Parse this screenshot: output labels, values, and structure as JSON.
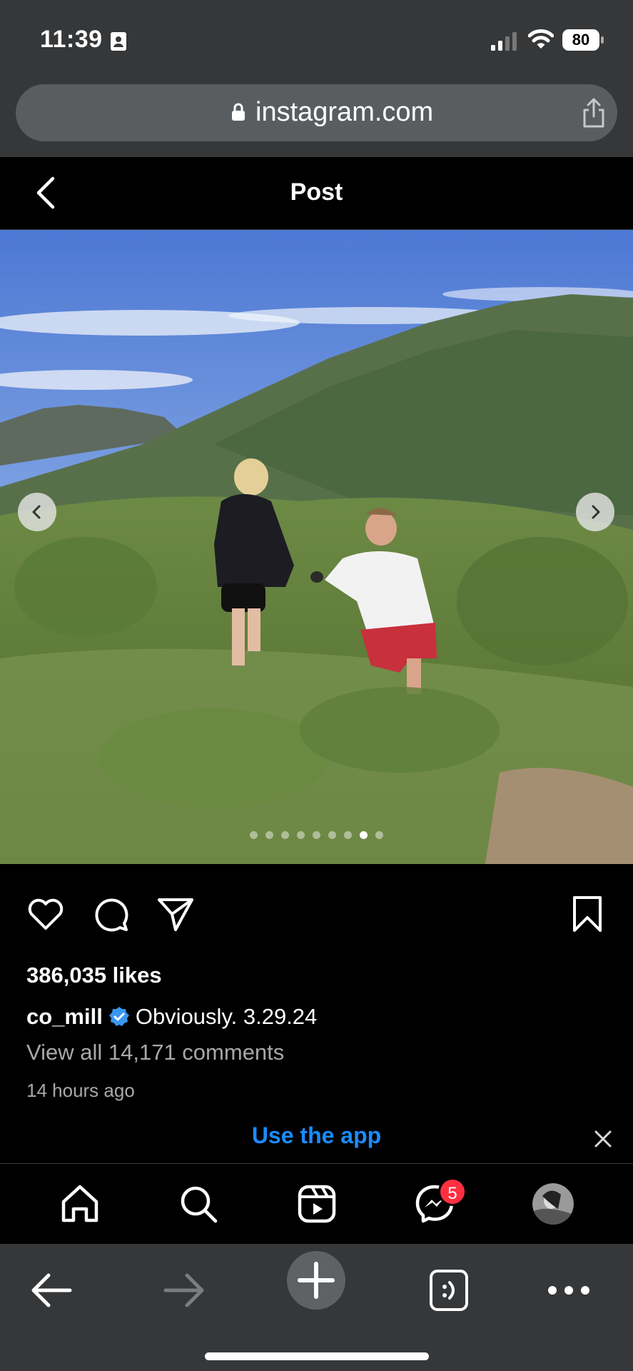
{
  "status_bar": {
    "time": "11:39",
    "battery": "80",
    "icons": [
      "contact-card-icon",
      "signal-icon",
      "wifi-icon",
      "battery-icon"
    ]
  },
  "browser": {
    "url": "instagram.com",
    "icons": [
      "lock-icon",
      "share-icon"
    ]
  },
  "header": {
    "title": "Post",
    "back_icon": "chevron-left-icon"
  },
  "post": {
    "image_icon": "photo-proposal-on-hillside",
    "carousel_total": 9,
    "carousel_active": 8,
    "likes": "386,035 likes",
    "username": "co_mill",
    "caption": "Obviously. 3.29.24",
    "view_comments": "View all 14,171 comments",
    "time_ago": "14 hours ago",
    "actions": [
      "heart-icon",
      "comment-icon",
      "send-icon",
      "bookmark-icon"
    ]
  },
  "banner": {
    "use_app": "Use the app",
    "close_icon": "close-icon"
  },
  "nav": {
    "items": [
      "home-icon",
      "search-icon",
      "reels-icon",
      "messenger-icon",
      "profile-avatar"
    ],
    "messages_badge": "5"
  },
  "safari_toolbar": {
    "items": [
      "back-arrow-icon",
      "forward-arrow-icon",
      "new-tab-plus-icon",
      "tabs-icon",
      "more-icon"
    ]
  },
  "colors": {
    "accent_blue": "#1a8cff",
    "badge_red": "#ff3040",
    "chrome_gray": "#353739"
  }
}
